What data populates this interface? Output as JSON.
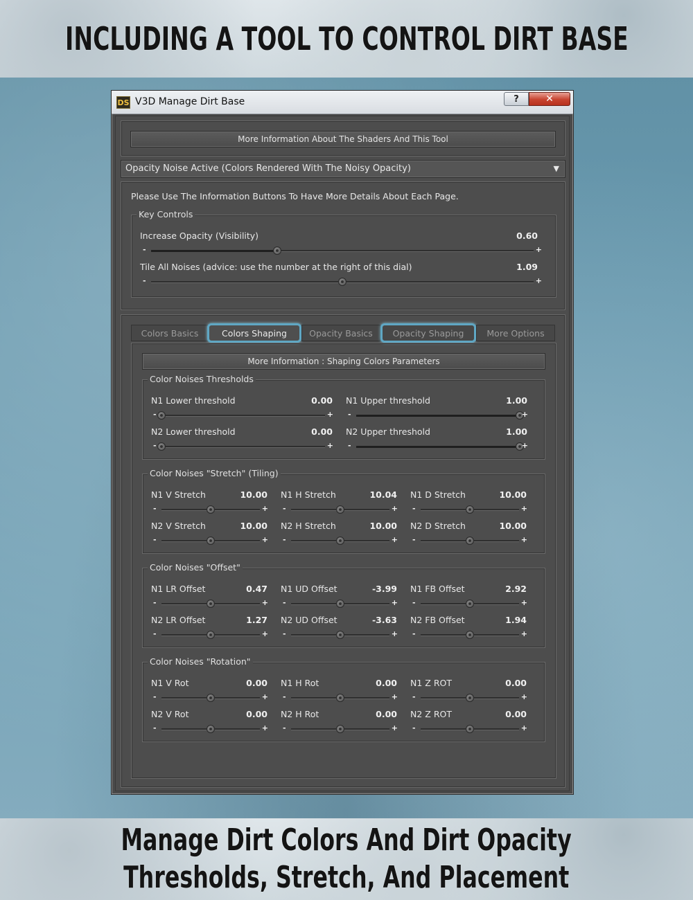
{
  "banner": {
    "top": "INCLUDING A TOOL TO CONTROL DIRT BASE",
    "bottom_line1": "Manage Dirt Colors And Dirt Opacity",
    "bottom_line2": "Thresholds, Stretch, And Placement"
  },
  "window": {
    "icon": "DS",
    "title": "V3D Manage Dirt Base",
    "help_label": "?",
    "close_label": "✕"
  },
  "info_button": "More Information About The Shaders And This Tool",
  "mode_dropdown": {
    "value": "Opacity Noise Active (Colors Rendered With The Noisy Opacity)",
    "arrow": "▼"
  },
  "key_panel": {
    "hint": "Please Use The Information Buttons To Have More Details About Each Page.",
    "group_title": "Key Controls",
    "controls": [
      {
        "label": "Increase Opacity (Visibility)",
        "value": "0.60",
        "minus": "-",
        "plus": "+",
        "position": 0.33
      },
      {
        "label": "Tile All Noises (advice: use the number at the right of this dial)",
        "value": "1.09",
        "minus": "-",
        "plus": "+",
        "position": 0.5
      }
    ]
  },
  "tabs": [
    {
      "label": "Colors Basics",
      "active": false
    },
    {
      "label": "Colors Shaping",
      "active": true
    },
    {
      "label": "Opacity Basics",
      "active": false
    },
    {
      "label": "Opacity Shaping",
      "active": false
    },
    {
      "label": "More Options",
      "active": false
    }
  ],
  "shaping": {
    "info_button": "More Information : Shaping Colors Parameters",
    "thresholds": {
      "title": "Color Noises Thresholds",
      "items": [
        {
          "label": "N1 Lower threshold",
          "value": "0.00",
          "position": 0.0
        },
        {
          "label": "N1 Upper threshold",
          "value": "1.00",
          "position": 1.0
        },
        {
          "label": "N2 Lower threshold",
          "value": "0.00",
          "position": 0.0
        },
        {
          "label": "N2 Upper threshold",
          "value": "1.00",
          "position": 1.0
        }
      ]
    },
    "stretch": {
      "title": "Color Noises \"Stretch\" (Tiling)",
      "items": [
        {
          "label": "N1 V Stretch",
          "value": "10.00",
          "position": 0.5
        },
        {
          "label": "N1 H Stretch",
          "value": "10.04",
          "position": 0.5
        },
        {
          "label": "N1 D Stretch",
          "value": "10.00",
          "position": 0.5
        },
        {
          "label": "N2 V Stretch",
          "value": "10.00",
          "position": 0.5
        },
        {
          "label": "N2 H Stretch",
          "value": "10.00",
          "position": 0.5
        },
        {
          "label": "N2 D Stretch",
          "value": "10.00",
          "position": 0.5
        }
      ]
    },
    "offset": {
      "title": "Color Noises \"Offset\"",
      "items": [
        {
          "label": "N1 LR Offset",
          "value": "0.47",
          "position": 0.5
        },
        {
          "label": "N1 UD Offset",
          "value": "-3.99",
          "position": 0.5
        },
        {
          "label": "N1 FB Offset",
          "value": "2.92",
          "position": 0.5
        },
        {
          "label": "N2 LR Offset",
          "value": "1.27",
          "position": 0.5
        },
        {
          "label": "N2 UD Offset",
          "value": "-3.63",
          "position": 0.5
        },
        {
          "label": "N2 FB Offset",
          "value": "1.94",
          "position": 0.5
        }
      ]
    },
    "rotation": {
      "title": "Color Noises \"Rotation\"",
      "items": [
        {
          "label": "N1 V Rot",
          "value": "0.00",
          "position": 0.5
        },
        {
          "label": "N1 H Rot",
          "value": "0.00",
          "position": 0.5
        },
        {
          "label": "N1 Z ROT",
          "value": "0.00",
          "position": 0.5
        },
        {
          "label": "N2 V Rot",
          "value": "0.00",
          "position": 0.5
        },
        {
          "label": "N2 H Rot",
          "value": "0.00",
          "position": 0.5
        },
        {
          "label": "N2 Z ROT",
          "value": "0.00",
          "position": 0.5
        }
      ]
    }
  },
  "colors": {
    "accent_ring": "#5fa7c4",
    "panel_bg": "#4d4d4d",
    "close_red": "#c7432f"
  }
}
